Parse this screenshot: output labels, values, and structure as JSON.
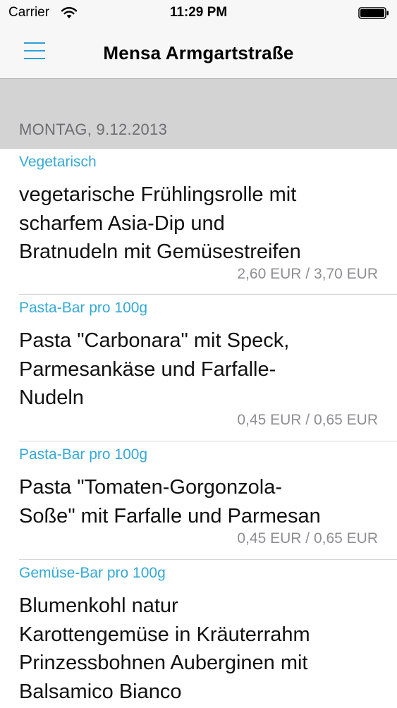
{
  "status_bar": {
    "carrier": "Carrier",
    "time": "11:29 PM",
    "wifi_icon": "wifi-icon",
    "battery_icon": "battery-icon"
  },
  "nav": {
    "title": "Mensa Armgartstraße",
    "menu_icon": "menu-icon",
    "accent_color": "#2e9fd6"
  },
  "section": {
    "date": "MONTAG, 9.12.2013"
  },
  "meals": [
    {
      "category": "Vegetarisch",
      "lines": [
        "vegetarische Frühlingsrolle mit",
        "scharfem Asia-Dip und",
        "Bratnudeln mit Gemüsestreifen"
      ],
      "price": "2,60 EUR / 3,70 EUR"
    },
    {
      "category": "Pasta-Bar pro 100g",
      "lines": [
        "Pasta \"Carbonara\" mit Speck,",
        "Parmesankäse und Farfalle-",
        "Nudeln"
      ],
      "price": "0,45 EUR / 0,65 EUR"
    },
    {
      "category": "Pasta-Bar pro 100g",
      "lines": [
        "Pasta \"Tomaten-Gorgonzola-",
        "Soße\" mit Farfalle und Parmesan"
      ],
      "price": "0,45 EUR / 0,65 EUR"
    },
    {
      "category": "Gemüse-Bar pro 100g",
      "lines": [
        "Blumenkohl natur",
        "Karottengemüse in Kräuterrahm",
        "Prinzessbohnen Auberginen mit",
        "Balsamico Bianco"
      ],
      "price": ""
    }
  ],
  "colors": {
    "category_text": "#34a9d6",
    "price_text": "#8e8e93",
    "section_bg": "#d3d3d3"
  }
}
